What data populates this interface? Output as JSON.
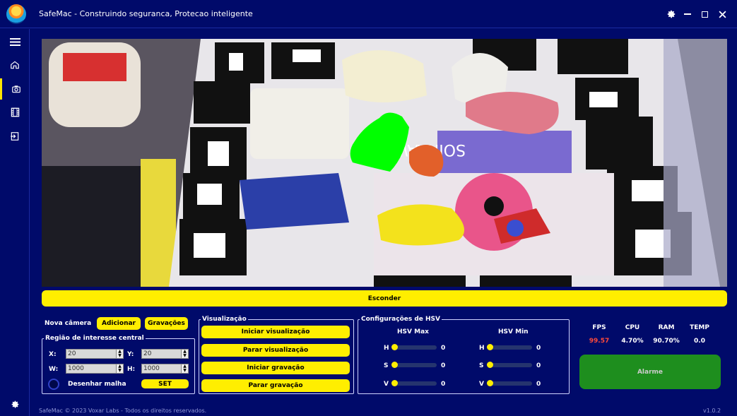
{
  "app": {
    "title": "SafeMac - Construindo seguranca, Protecao inteligente"
  },
  "window_controls": [
    "settings-icon",
    "minimize-icon",
    "maximize-icon",
    "close-icon"
  ],
  "sidebar": {
    "items": [
      {
        "icon": "menu-icon",
        "active": false
      },
      {
        "icon": "home-icon",
        "active": false
      },
      {
        "icon": "camera-icon",
        "active": true
      },
      {
        "icon": "film-icon",
        "active": false
      },
      {
        "icon": "logout-icon",
        "active": false
      }
    ],
    "bottom_icon": "gear-icon"
  },
  "video": {
    "icon": "camera-feed-image"
  },
  "hide_button": "Esconder",
  "camera": {
    "label": "Nova câmera",
    "add_button": "Adicionar",
    "recordings_button": "Gravações"
  },
  "roi": {
    "legend": "Região de interesse central",
    "x_label": "X:",
    "x_value": "20",
    "y_label": "Y:",
    "y_value": "20",
    "w_label": "W:",
    "w_value": "1000",
    "h_label": "H:",
    "h_value": "1000",
    "grid_label": "Desenhar malha",
    "set_button": "SET"
  },
  "visualization": {
    "legend": "Visualização",
    "start_view": "Iniciar visualização",
    "stop_view": "Parar visualização",
    "start_rec": "Iniciar gravação",
    "stop_rec": "Parar gravação"
  },
  "hsv": {
    "legend": "Configurações de HSV",
    "max_title": "HSV Max",
    "min_title": "HSV Min",
    "max": [
      {
        "label": "H",
        "value": "0"
      },
      {
        "label": "S",
        "value": "0"
      },
      {
        "label": "V",
        "value": "0"
      }
    ],
    "min": [
      {
        "label": "H",
        "value": "0"
      },
      {
        "label": "S",
        "value": "0"
      },
      {
        "label": "V",
        "value": "0"
      }
    ]
  },
  "stats": {
    "fps_label": "FPS",
    "fps_value": "99.57",
    "cpu_label": "CPU",
    "cpu_value": "4.70%",
    "ram_label": "RAM",
    "ram_value": "90.70%",
    "temp_label": "TEMP",
    "temp_value": "0.0"
  },
  "alarm_button": "Alarme",
  "footer": "SafeMac © 2023 Voxar Labs - Todos os direitos reservados.",
  "version": "v1.0.2",
  "colors": {
    "background": "#000a6a",
    "accent": "#ffee00",
    "fps_value": "#ff4a3a",
    "alarm": "#1e8e1e"
  }
}
